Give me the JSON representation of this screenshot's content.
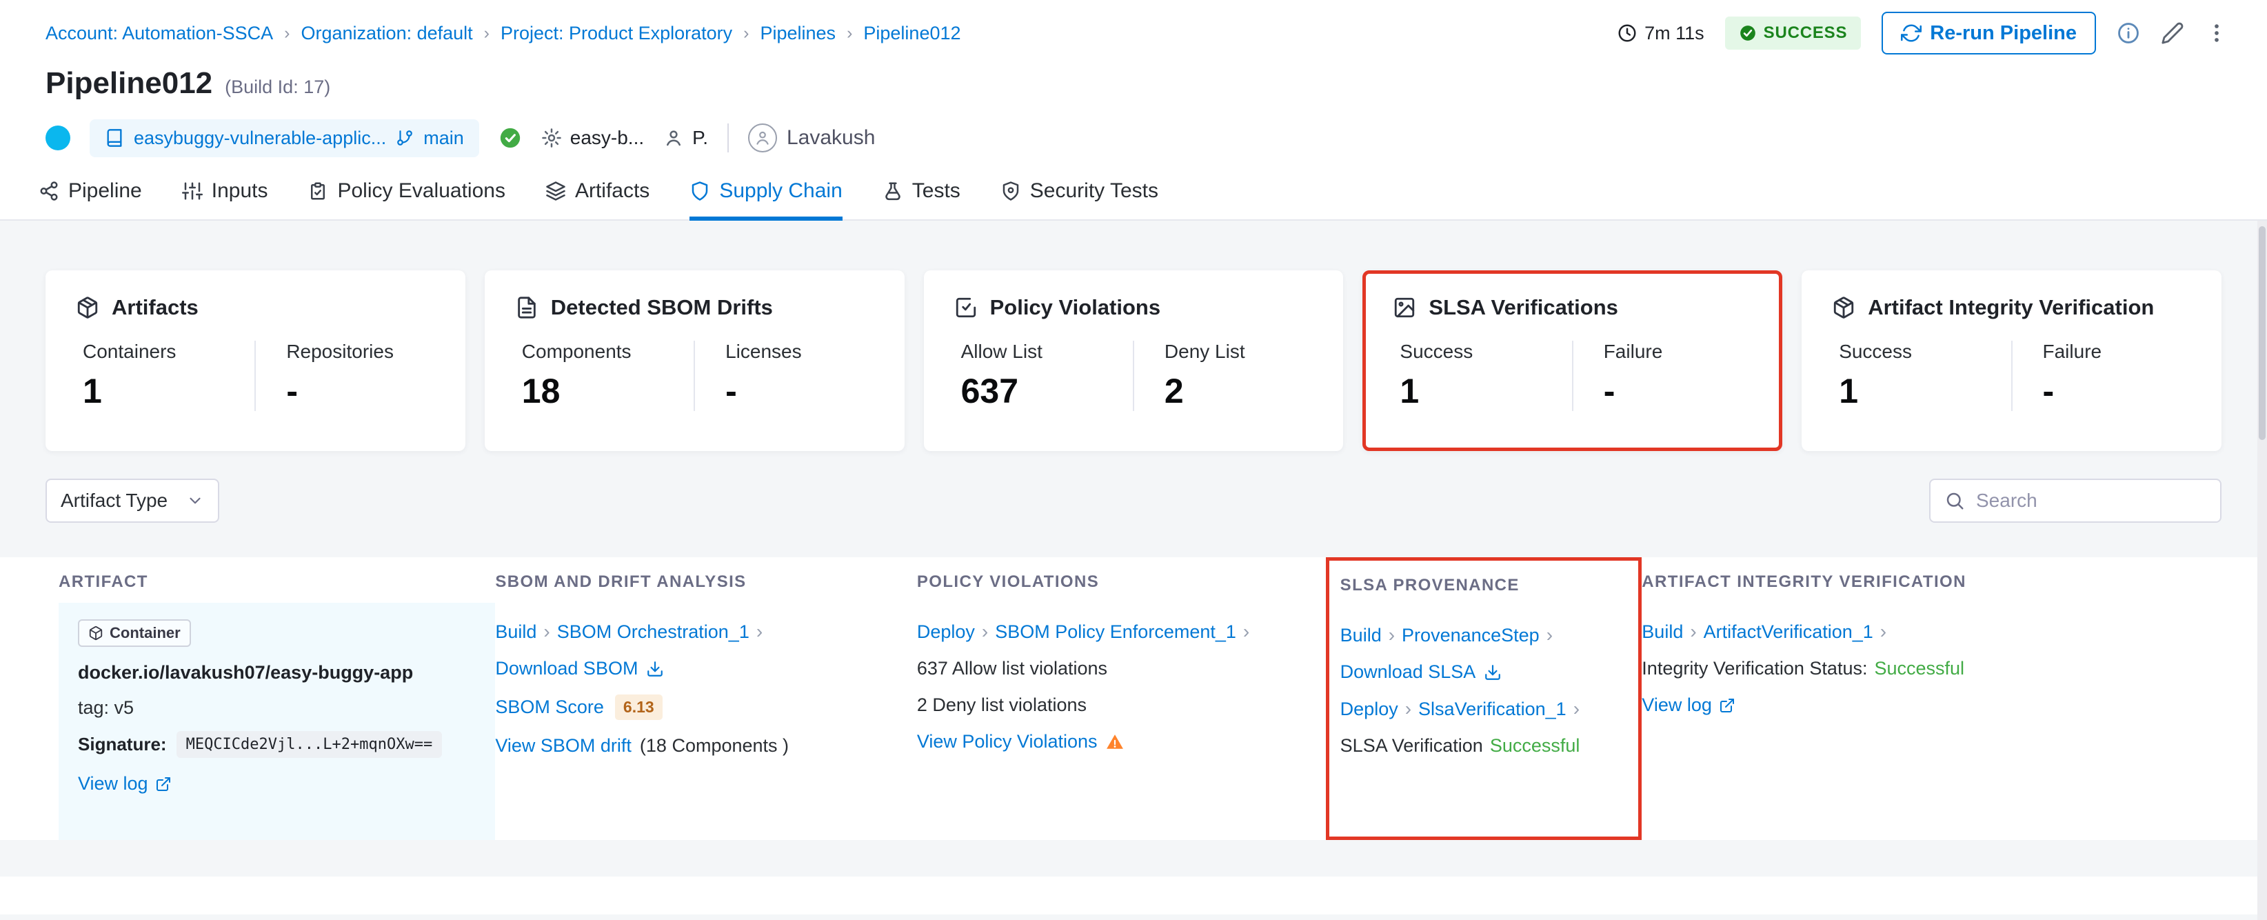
{
  "breadcrumb": {
    "items": [
      "Account: Automation-SSCA",
      "Organization: default",
      "Project: Product Exploratory",
      "Pipelines",
      "Pipeline012"
    ]
  },
  "header": {
    "duration": "7m 11s",
    "status": "SUCCESS",
    "rerun_label": "Re-run Pipeline",
    "title": "Pipeline012",
    "build_id": "(Build Id: 17)",
    "repo": "easybuggy-vulnerable-applic...",
    "branch": "main",
    "service": "easy-b...",
    "env_short": "P.",
    "user": "Lavakush"
  },
  "tabs": [
    {
      "label": "Pipeline"
    },
    {
      "label": "Inputs"
    },
    {
      "label": "Policy Evaluations"
    },
    {
      "label": "Artifacts"
    },
    {
      "label": "Supply Chain"
    },
    {
      "label": "Tests"
    },
    {
      "label": "Security Tests"
    }
  ],
  "cards": [
    {
      "title": "Artifacts",
      "cols": [
        {
          "label": "Containers",
          "value": "1"
        },
        {
          "label": "Repositories",
          "value": "-"
        }
      ]
    },
    {
      "title": "Detected SBOM Drifts",
      "cols": [
        {
          "label": "Components",
          "value": "18"
        },
        {
          "label": "Licenses",
          "value": "-"
        }
      ]
    },
    {
      "title": "Policy Violations",
      "cols": [
        {
          "label": "Allow List",
          "value": "637"
        },
        {
          "label": "Deny List",
          "value": "2"
        }
      ]
    },
    {
      "title": "SLSA Verifications",
      "cols": [
        {
          "label": "Success",
          "value": "1"
        },
        {
          "label": "Failure",
          "value": "-"
        }
      ]
    },
    {
      "title": "Artifact Integrity Verification",
      "cols": [
        {
          "label": "Success",
          "value": "1"
        },
        {
          "label": "Failure",
          "value": "-"
        }
      ]
    }
  ],
  "filters": {
    "artifact_type_label": "Artifact Type",
    "search_placeholder": "Search"
  },
  "table": {
    "headers": [
      "ARTIFACT",
      "SBOM AND DRIFT ANALYSIS",
      "POLICY VIOLATIONS",
      "SLSA PROVENANCE",
      "ARTIFACT INTEGRITY VERIFICATION"
    ],
    "row": {
      "artifact": {
        "type_badge": "Container",
        "image": "docker.io/lavakush07/easy-buggy-app",
        "tag": "tag: v5",
        "signature_label": "Signature:",
        "signature": "MEQCICde2Vjl...L+2+mqnOXw==",
        "view_log": "View log"
      },
      "sbom": {
        "stage": "Build",
        "step": "SBOM Orchestration_1",
        "download": "Download SBOM",
        "score_label": "SBOM Score",
        "score": "6.13",
        "drift": "View SBOM drift",
        "components": "(18 Components )"
      },
      "policy": {
        "stage": "Deploy",
        "step": "SBOM Policy Enforcement_1",
        "allow": "637 Allow list violations",
        "deny": "2 Deny list violations",
        "view": "View Policy Violations"
      },
      "slsa": {
        "stage1": "Build",
        "step1": "ProvenanceStep",
        "download": "Download SLSA",
        "stage2": "Deploy",
        "step2": "SlsaVerification_1",
        "status_text": "SLSA Verification",
        "status_value": "Successful"
      },
      "integrity": {
        "stage": "Build",
        "step": "ArtifactVerification_1",
        "status_text": "Integrity Verification Status:",
        "status_value": "Successful",
        "view_log": "View log"
      }
    }
  },
  "colors": {
    "blue": "#0278d5",
    "red": "#e23725",
    "green": "#42ab45",
    "success_bg": "#e4f7e7",
    "success_text": "#1b841d",
    "warning": "#ff832b",
    "gray_bg": "#f4f6f8",
    "border": "#d9dae5",
    "artifact_bg": "#f1fafe",
    "score_bg": "#fbeedd",
    "score_text": "#b26419"
  }
}
